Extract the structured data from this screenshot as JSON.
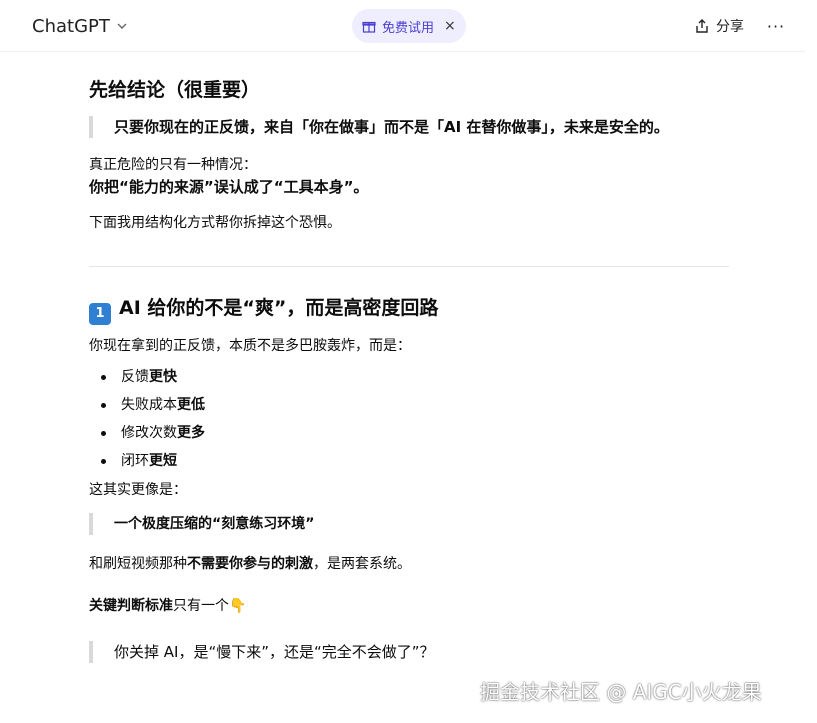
{
  "header": {
    "model_name": "ChatGPT",
    "trial_label": "免费试用",
    "trial_close": "×",
    "share_label": "分享",
    "more_label": "···"
  },
  "content": {
    "heading1": "先给结论（很重要）",
    "quote1": "只要你现在的正反馈，来自「你在做事」而不是「AI 在替你做事」，未来是安全的。",
    "para1": "真正危险的只有一种情况：",
    "para1_bold": "你把“能力的来源”误认成了“工具本身”。",
    "para2": "下面我用结构化方式帮你拆掉这个恐惧。",
    "section1_badge": "1",
    "section1_title": "AI 给你的不是“爽”，而是高密度回路",
    "section1_intro": "你现在拿到的正反馈，本质不是多巴胺轰炸，而是：",
    "bullets": [
      {
        "plain": "反馈",
        "bold": "更快"
      },
      {
        "plain": "失败成本",
        "bold": "更低"
      },
      {
        "plain": "修改次数",
        "bold": "更多"
      },
      {
        "plain": "闭环",
        "bold": "更短"
      }
    ],
    "more_like": "这其实更像是：",
    "quote2": "一个极度压缩的“刻意练习环境”",
    "contrast_pre": "和刷短视频那种",
    "contrast_bold": "不需要你参与的刺激",
    "contrast_post": "，是两套系统。",
    "criteria_bold": "关键判断标准",
    "criteria_plain": "只有一个",
    "criteria_emoji": "👇",
    "quote3": "你关掉 AI，是“慢下来”，还是“完全不会做了”？"
  },
  "watermark": "掘金技术社区 @ AIGC小火龙果",
  "colors": {
    "accent": "#4b3fd1",
    "pill_bg": "#efeefe",
    "badge_blue": "#2f7fd3",
    "quote_bar": "#d9d9d9"
  }
}
